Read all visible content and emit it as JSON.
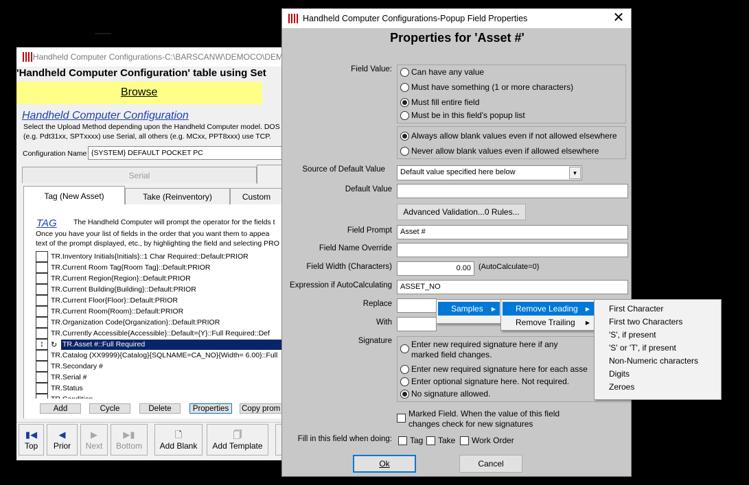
{
  "colors": {
    "accent": "#0078d7",
    "list_selection": "#0a246a",
    "browse_bar": "#ffff88",
    "heading_link": "#1f3fb5",
    "dialog_bg": "#c8c8c8"
  },
  "background_window": {
    "title": "Handheld Computer Configurations-C:\\BARSCANW\\DEMOCO\\DEM",
    "heading": "'Handheld Computer Configuration' table using Set",
    "browse_label": "Browse",
    "section_link": "Handheld Computer Configuration",
    "description_line1": "Select the Upload Method depending upon the Handheld Computer model. DOS",
    "description_line2": "(e.g. Pdt31xx, SPTxxxx) use Serial, all others (e.g. MCxx, PPT8xxx) use TCP.",
    "config_name_label": "Configuration Name",
    "config_name_value": "{SYSTEM} DEFAULT POCKET PC",
    "upload_tabs": [
      "Serial"
    ],
    "tabs": [
      "Tag (New Asset)",
      "Take (Reinventory)",
      "Custom"
    ],
    "tag_link": "TAG",
    "tag_text_line1": "The Handheld Computer will prompt the operator for the fields t",
    "tag_text_line2": "Once you have your list of fields in the order that you want them to appea",
    "tag_text_line3": "text of the prompt displayed, etc., by highlighting the field and selecting PRO",
    "list_items": [
      "TR.Inventory Initials{Initials}::1 Char Required::Default:PRIOR",
      "TR.Current Room Tag{Room Tag}::Default:PRIOR",
      "TR.Current Region{Region}::Default:PRIOR",
      "TR.Current Building{Building}::Default:PRIOR",
      "TR.Current Floor{Floor}::Default:PRIOR",
      "TR.Current Room{Room}::Default:PRIOR",
      "TR.Organization Code{Organization}::Default:PRIOR",
      "TR.Currently Accessible{Accessible}::Default={Y}::Full Required::Def",
      "TR.Asset #::Full Required",
      "TR.Catalog (XX9999){Catalog}{SQLNAME=CA_NO}{Width= 6.00}::Full",
      "TR.Secondary #",
      "TR.Serial #",
      "TR.Status",
      "TR.Condition"
    ],
    "list_buttons": [
      "Add",
      "Cycle",
      "Delete",
      "Properties",
      "Copy prom"
    ],
    "nav_buttons": [
      {
        "label": "Top",
        "icon": "first-icon"
      },
      {
        "label": "Prior",
        "icon": "prior-icon"
      },
      {
        "label": "Next",
        "icon": "next-icon"
      },
      {
        "label": "Bottom",
        "icon": "last-icon"
      },
      {
        "label": "Add Blank",
        "icon": "blank-page-icon"
      },
      {
        "label": "Add Template",
        "icon": "template-icon"
      }
    ]
  },
  "dialog": {
    "title": "Handheld Computer Configurations-Popup Field Properties",
    "heading": "Properties for 'Asset #'",
    "field_value_label": "Field Value:",
    "field_value_options": [
      "Can have any value",
      "Must have something (1 or more characters)",
      "Must fill entire field",
      "Must be in this field's popup list"
    ],
    "field_value_selected": "Must fill entire field",
    "blank_options": [
      "Always allow blank values even if not allowed elsewhere",
      "Never allow blank values even if allowed elsewhere"
    ],
    "blank_selected": "Always allow blank values even if not allowed elsewhere",
    "source_default_label": "Source of Default Value",
    "source_default_value": "Default value specified here below",
    "default_value_label": "Default Value",
    "default_value": "",
    "advanced_validation_label": "Advanced Validation...0 Rules...",
    "field_prompt_label": "Field Prompt",
    "field_prompt_value": "Asset #",
    "field_name_override_label": "Field Name Override",
    "field_name_override_value": "",
    "field_width_label": "Field Width (Characters)",
    "field_width_value": "0.00",
    "autocalc_note": "(AutoCalculate=0)",
    "expression_label": "Expression if AutoCalculating",
    "expression_value": "ASSET_NO",
    "replace_label": "Replace",
    "with_label": "With",
    "signature_label": "Signature",
    "signature_options": [
      "Enter new required signature here if any marked field changes.",
      "Enter new required signature here for each asse",
      "Enter optional signature here. Not required.",
      "No signature allowed."
    ],
    "signature_selected": "No signature allowed.",
    "marked_field_line1": "Marked Field. When the value of this field",
    "marked_field_line2": "changes check for new signatures",
    "fill_in_label": "Fill in this field when doing:",
    "fill_in_options": [
      "Tag",
      "Take",
      "Work Order"
    ],
    "ok_label": "Ok",
    "cancel_label": "Cancel"
  },
  "context_menu": {
    "level1": [
      "Samples"
    ],
    "level2": [
      "Remove Leading",
      "Remove Trailing"
    ],
    "level3": [
      "First Character",
      "First two Characters",
      "'S', if present",
      "'S' or 'T', if present",
      "Non-Numeric characters",
      "Digits",
      "Zeroes"
    ]
  }
}
